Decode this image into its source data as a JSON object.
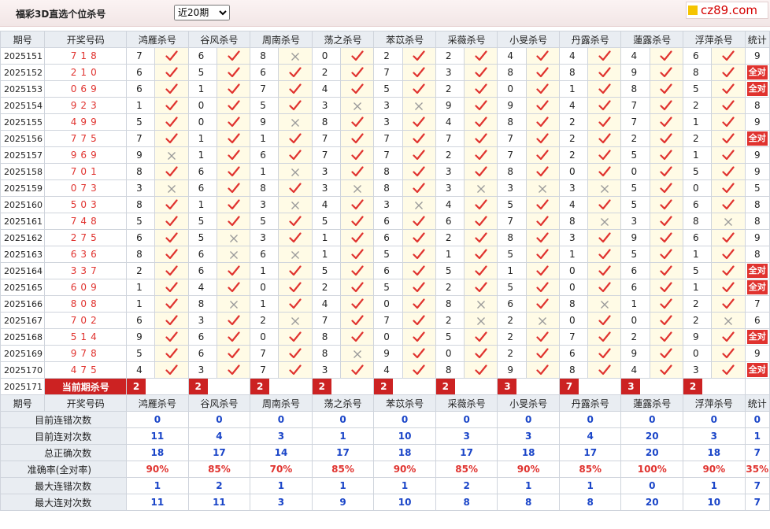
{
  "header": {
    "title": "福彩3D直选个位杀号",
    "period_select": "近20期",
    "site_logo": "cz89.com"
  },
  "columns": {
    "period": "期号",
    "draw": "开奖号码",
    "stat": "统计",
    "experts": [
      "鸿雁杀号",
      "谷风杀号",
      "周南杀号",
      "荡之杀号",
      "苯苡杀号",
      "采薇杀号",
      "小旻杀号",
      "丹露杀号",
      "蓮露杀号",
      "浮萍杀号"
    ]
  },
  "rows": [
    {
      "period": "2025151",
      "draw": "718",
      "kills": [
        7,
        6,
        8,
        0,
        2,
        2,
        4,
        4,
        4,
        6
      ],
      "ok": [
        1,
        1,
        0,
        1,
        1,
        1,
        1,
        1,
        1,
        1
      ],
      "stat": "9"
    },
    {
      "period": "2025152",
      "draw": "210",
      "kills": [
        6,
        5,
        6,
        2,
        7,
        3,
        8,
        8,
        9,
        8
      ],
      "ok": [
        1,
        1,
        1,
        1,
        1,
        1,
        1,
        1,
        1,
        1
      ],
      "stat": "全对"
    },
    {
      "period": "2025153",
      "draw": "069",
      "kills": [
        6,
        1,
        7,
        4,
        5,
        2,
        0,
        1,
        8,
        5
      ],
      "ok": [
        1,
        1,
        1,
        1,
        1,
        1,
        1,
        1,
        1,
        1
      ],
      "stat": "全对"
    },
    {
      "period": "2025154",
      "draw": "923",
      "kills": [
        1,
        0,
        5,
        3,
        3,
        9,
        9,
        4,
        7,
        2
      ],
      "ok": [
        1,
        1,
        1,
        0,
        0,
        1,
        1,
        1,
        1,
        1
      ],
      "stat": "8"
    },
    {
      "period": "2025155",
      "draw": "499",
      "kills": [
        5,
        0,
        9,
        8,
        3,
        4,
        8,
        2,
        7,
        1
      ],
      "ok": [
        1,
        1,
        0,
        1,
        1,
        1,
        1,
        1,
        1,
        1
      ],
      "stat": "9"
    },
    {
      "period": "2025156",
      "draw": "775",
      "kills": [
        7,
        1,
        1,
        7,
        7,
        7,
        7,
        2,
        2,
        2
      ],
      "ok": [
        1,
        1,
        1,
        1,
        1,
        1,
        1,
        1,
        1,
        1
      ],
      "stat": "全对"
    },
    {
      "period": "2025157",
      "draw": "969",
      "kills": [
        9,
        1,
        6,
        7,
        7,
        2,
        7,
        2,
        5,
        1
      ],
      "ok": [
        0,
        1,
        1,
        1,
        1,
        1,
        1,
        1,
        1,
        1
      ],
      "stat": "9"
    },
    {
      "period": "2025158",
      "draw": "701",
      "kills": [
        8,
        6,
        1,
        3,
        8,
        3,
        8,
        0,
        0,
        5
      ],
      "ok": [
        1,
        1,
        0,
        1,
        1,
        1,
        1,
        1,
        1,
        1
      ],
      "stat": "9"
    },
    {
      "period": "2025159",
      "draw": "073",
      "kills": [
        3,
        6,
        8,
        3,
        8,
        3,
        3,
        3,
        5,
        0
      ],
      "ok": [
        0,
        1,
        1,
        0,
        1,
        0,
        0,
        0,
        1,
        1
      ],
      "stat": "5"
    },
    {
      "period": "2025160",
      "draw": "503",
      "kills": [
        8,
        1,
        3,
        4,
        3,
        4,
        5,
        4,
        5,
        6
      ],
      "ok": [
        1,
        1,
        0,
        1,
        0,
        1,
        1,
        1,
        1,
        1
      ],
      "stat": "8"
    },
    {
      "period": "2025161",
      "draw": "748",
      "kills": [
        5,
        5,
        5,
        5,
        6,
        6,
        7,
        8,
        3,
        8
      ],
      "ok": [
        1,
        1,
        1,
        1,
        1,
        1,
        1,
        0,
        1,
        0
      ],
      "stat": "8"
    },
    {
      "period": "2025162",
      "draw": "275",
      "kills": [
        6,
        5,
        3,
        1,
        6,
        2,
        8,
        3,
        9,
        6
      ],
      "ok": [
        1,
        0,
        1,
        1,
        1,
        1,
        1,
        1,
        1,
        1
      ],
      "stat": "9"
    },
    {
      "period": "2025163",
      "draw": "636",
      "kills": [
        8,
        6,
        6,
        1,
        5,
        1,
        5,
        1,
        5,
        1
      ],
      "ok": [
        1,
        0,
        0,
        1,
        1,
        1,
        1,
        1,
        1,
        1
      ],
      "stat": "8"
    },
    {
      "period": "2025164",
      "draw": "337",
      "kills": [
        2,
        6,
        1,
        5,
        6,
        5,
        1,
        0,
        6,
        5
      ],
      "ok": [
        1,
        1,
        1,
        1,
        1,
        1,
        1,
        1,
        1,
        1
      ],
      "stat": "全对"
    },
    {
      "period": "2025165",
      "draw": "609",
      "kills": [
        1,
        4,
        0,
        2,
        5,
        2,
        5,
        0,
        6,
        1
      ],
      "ok": [
        1,
        1,
        1,
        1,
        1,
        1,
        1,
        1,
        1,
        1
      ],
      "stat": "全对"
    },
    {
      "period": "2025166",
      "draw": "808",
      "kills": [
        1,
        8,
        1,
        4,
        0,
        8,
        6,
        8,
        1,
        2
      ],
      "ok": [
        1,
        0,
        1,
        1,
        1,
        0,
        1,
        0,
        1,
        1
      ],
      "stat": "7"
    },
    {
      "period": "2025167",
      "draw": "702",
      "kills": [
        6,
        3,
        2,
        7,
        7,
        2,
        2,
        0,
        0,
        2
      ],
      "ok": [
        1,
        1,
        0,
        1,
        1,
        0,
        0,
        1,
        1,
        0
      ],
      "stat": "6"
    },
    {
      "period": "2025168",
      "draw": "514",
      "kills": [
        9,
        6,
        0,
        8,
        0,
        5,
        2,
        7,
        2,
        9
      ],
      "ok": [
        1,
        1,
        1,
        1,
        1,
        1,
        1,
        1,
        1,
        1
      ],
      "stat": "全对"
    },
    {
      "period": "2025169",
      "draw": "978",
      "kills": [
        5,
        6,
        7,
        8,
        9,
        0,
        2,
        6,
        9,
        0
      ],
      "ok": [
        1,
        1,
        1,
        0,
        1,
        1,
        1,
        1,
        1,
        1
      ],
      "stat": "9"
    },
    {
      "period": "2025170",
      "draw": "475",
      "kills": [
        4,
        3,
        7,
        3,
        4,
        8,
        9,
        8,
        4,
        3
      ],
      "ok": [
        1,
        1,
        1,
        1,
        1,
        1,
        1,
        1,
        1,
        1
      ],
      "stat": "全对"
    }
  ],
  "current": {
    "period": "2025171",
    "label": "当前期杀号",
    "kills": [
      2,
      2,
      2,
      2,
      2,
      2,
      3,
      7,
      3,
      2
    ]
  },
  "stats": [
    {
      "label": "目前连错次数",
      "values": [
        "0",
        "0",
        "0",
        "0",
        "0",
        "0",
        "0",
        "0",
        "0",
        "0",
        "0"
      ],
      "color": "blue"
    },
    {
      "label": "目前连对次数",
      "values": [
        "11",
        "4",
        "3",
        "1",
        "10",
        "3",
        "3",
        "4",
        "20",
        "3",
        "1"
      ],
      "color": "blue"
    },
    {
      "label": "总正确次数",
      "values": [
        "18",
        "17",
        "14",
        "17",
        "18",
        "17",
        "18",
        "17",
        "20",
        "18",
        "7"
      ],
      "color": "blue"
    },
    {
      "label": "准确率(全对率)",
      "values": [
        "90%",
        "85%",
        "70%",
        "85%",
        "90%",
        "85%",
        "90%",
        "85%",
        "100%",
        "90%",
        "35%"
      ],
      "color": "red"
    },
    {
      "label": "最大连错次数",
      "values": [
        "1",
        "2",
        "1",
        "1",
        "1",
        "2",
        "1",
        "1",
        "0",
        "1",
        "7"
      ],
      "color": "blue"
    },
    {
      "label": "最大连对次数",
      "values": [
        "11",
        "11",
        "3",
        "9",
        "10",
        "8",
        "8",
        "8",
        "20",
        "10",
        "7"
      ],
      "color": "blue"
    }
  ]
}
